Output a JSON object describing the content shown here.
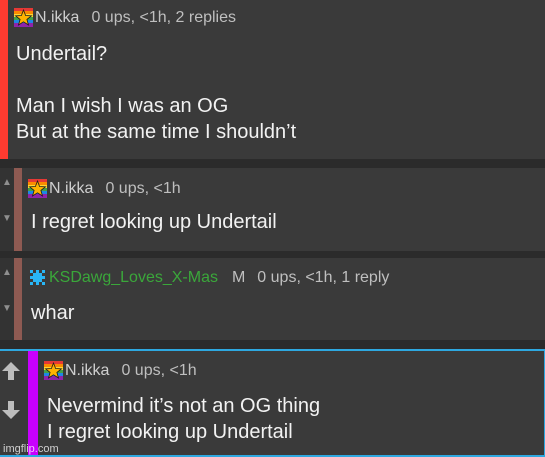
{
  "comments": [
    {
      "username": "N.ikka",
      "meta": "0 ups, <1h, 2 replies",
      "lines": [
        "Undertail?",
        "",
        "Man I wish I was an OG",
        "But at the same time I shouldn’t"
      ],
      "accent_color": "#ff3b30"
    },
    {
      "username": "N.ikka",
      "meta": "0 ups, <1h",
      "lines": [
        "I regret looking up Undertail"
      ],
      "accent_color": "#8e5a52"
    },
    {
      "username": "KSDawg_Loves_X-Mas",
      "badge": "M",
      "meta": "0 ups, <1h, 1 reply",
      "lines": [
        "whar"
      ],
      "accent_color": "#8e5a52",
      "username_color": "#3aa73a"
    },
    {
      "username": "N.ikka",
      "meta": "0 ups, <1h",
      "lines": [
        "Nevermind it’s not an OG thing",
        "I regret looking up Undertail"
      ],
      "accent_color": "#c800ff",
      "border_color": "#2ea8e0"
    }
  ],
  "vote_icons": {
    "up": "up-arrow-icon",
    "down": "down-arrow-icon"
  },
  "watermark": "imgflip.com"
}
